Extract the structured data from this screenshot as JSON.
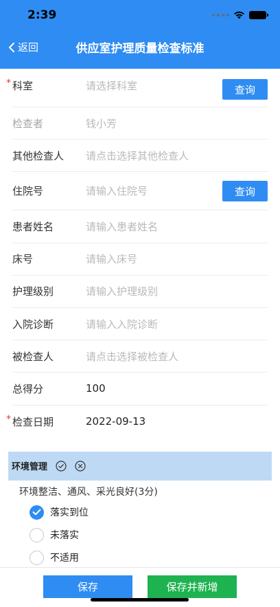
{
  "status_bar": {
    "time": "2:39"
  },
  "nav": {
    "back_label": "返回",
    "title": "供应室护理质量检查标准"
  },
  "form": {
    "query_label": "查询",
    "rows": [
      {
        "label": "科室",
        "value": "请选择科室"
      },
      {
        "label": "检查者",
        "value": "钱小芳"
      },
      {
        "label": "其他检查人",
        "value": "请点击选择其他检查人"
      },
      {
        "label": "住院号",
        "value": "请输入住院号"
      },
      {
        "label": "患者姓名",
        "value": "请输入患者姓名"
      },
      {
        "label": "床号",
        "value": "请输入床号"
      },
      {
        "label": "护理级别",
        "value": "请输入护理级别"
      },
      {
        "label": "入院诊断",
        "value": "请输入入院诊断"
      },
      {
        "label": "被检查人",
        "value": "请点击选择被检查人"
      },
      {
        "label": "总得分",
        "value": "100"
      },
      {
        "label": "检查日期",
        "value": "2022-09-13"
      }
    ],
    "required_mark": "*"
  },
  "section": {
    "title": "环境管理",
    "question": "环境整洁、通风、采光良好(3分)",
    "options": [
      {
        "label": "落实到位",
        "checked": true
      },
      {
        "label": "未落实",
        "checked": false
      },
      {
        "label": "不适用",
        "checked": false
      }
    ]
  },
  "bottom": {
    "save_label": "保存",
    "save_new_label": "保存并新增"
  },
  "colors": {
    "primary": "#2f8cf2",
    "success": "#1fb250",
    "section_bg": "#bdd9f4",
    "required": "#e23a3a"
  }
}
